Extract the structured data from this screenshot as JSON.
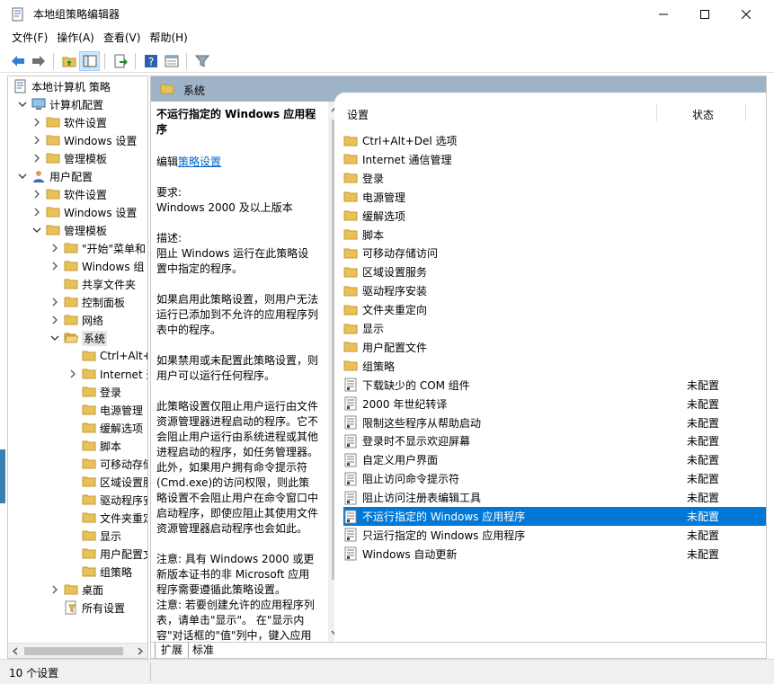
{
  "window": {
    "title": "本地组策略编辑器",
    "minimize_glyph": "—",
    "maximize_glyph": "☐",
    "close_glyph": "✕"
  },
  "menu": [
    "文件(F)",
    "操作(A)",
    "查看(V)",
    "帮助(H)"
  ],
  "toolbar": [
    "back-icon",
    "forward-icon",
    "up-folder-icon",
    "show-hide-tree-icon",
    "export-icon",
    "help-icon",
    "properties-icon",
    "filter-icon"
  ],
  "tree": [
    {
      "label": "本地计算机 策略",
      "icon": "policy-doc-icon",
      "expand": "",
      "indent": 0
    },
    {
      "label": "计算机配置",
      "icon": "computer-icon",
      "expand": "down",
      "indent": 1
    },
    {
      "label": "软件设置",
      "icon": "folder-icon",
      "expand": "right",
      "indent": 2
    },
    {
      "label": "Windows 设置",
      "icon": "folder-icon",
      "expand": "right",
      "indent": 2
    },
    {
      "label": "管理模板",
      "icon": "folder-icon",
      "expand": "right",
      "indent": 2
    },
    {
      "label": "用户配置",
      "icon": "user-icon",
      "expand": "down",
      "indent": 1
    },
    {
      "label": "软件设置",
      "icon": "folder-icon",
      "expand": "right",
      "indent": 2
    },
    {
      "label": "Windows 设置",
      "icon": "folder-icon",
      "expand": "right",
      "indent": 2
    },
    {
      "label": "管理模板",
      "icon": "folder-icon",
      "expand": "down",
      "indent": 2
    },
    {
      "label": "\"开始\"菜单和",
      "icon": "folder-icon",
      "expand": "right",
      "indent": 3
    },
    {
      "label": "Windows 组",
      "icon": "folder-icon",
      "expand": "right",
      "indent": 3
    },
    {
      "label": "共享文件夹",
      "icon": "folder-icon",
      "expand": "",
      "indent": 3
    },
    {
      "label": "控制面板",
      "icon": "folder-icon",
      "expand": "right",
      "indent": 3
    },
    {
      "label": "网络",
      "icon": "folder-icon",
      "expand": "right",
      "indent": 3
    },
    {
      "label": "系统",
      "icon": "folder-open-icon",
      "expand": "down",
      "indent": 3,
      "selected": true
    },
    {
      "label": "Ctrl+Alt+",
      "icon": "folder-icon",
      "expand": "",
      "indent": 4
    },
    {
      "label": "Internet 通",
      "icon": "folder-icon",
      "expand": "right",
      "indent": 4
    },
    {
      "label": "登录",
      "icon": "folder-icon",
      "expand": "",
      "indent": 4
    },
    {
      "label": "电源管理",
      "icon": "folder-icon",
      "expand": "",
      "indent": 4
    },
    {
      "label": "缓解选项",
      "icon": "folder-icon",
      "expand": "",
      "indent": 4
    },
    {
      "label": "脚本",
      "icon": "folder-icon",
      "expand": "",
      "indent": 4
    },
    {
      "label": "可移动存储",
      "icon": "folder-icon",
      "expand": "",
      "indent": 4
    },
    {
      "label": "区域设置服",
      "icon": "folder-icon",
      "expand": "",
      "indent": 4
    },
    {
      "label": "驱动程序安",
      "icon": "folder-icon",
      "expand": "",
      "indent": 4
    },
    {
      "label": "文件夹重定",
      "icon": "folder-icon",
      "expand": "",
      "indent": 4
    },
    {
      "label": "显示",
      "icon": "folder-icon",
      "expand": "",
      "indent": 4
    },
    {
      "label": "用户配置文",
      "icon": "folder-icon",
      "expand": "",
      "indent": 4
    },
    {
      "label": "组策略",
      "icon": "folder-icon",
      "expand": "",
      "indent": 4
    },
    {
      "label": "桌面",
      "icon": "folder-icon",
      "expand": "right",
      "indent": 3
    },
    {
      "label": "所有设置",
      "icon": "all-settings-icon",
      "expand": "",
      "indent": 3
    }
  ],
  "pane_header": "系统",
  "description": {
    "title": "不运行指定的 Windows 应用程序",
    "edit_prefix": "编辑",
    "edit_link": "策略设置",
    "requirements_label": "要求:",
    "requirements_value": "Windows 2000 及以上版本",
    "desc_label": "描述:",
    "desc_text": "阻止 Windows 运行在此策略设置中指定的程序。",
    "enabled_text": "如果启用此策略设置，则用户无法运行已添加到不允许的应用程序列表中的程序。",
    "disabled_text": "如果禁用或未配置此策略设置，则用户可以运行任何程序。",
    "scope_text": "此策略设置仅阻止用户运行由文件资源管理器进程启动的程序。它不会阻止用户运行由系统进程或其他进程启动的程序，如任务管理器。此外，如果用户拥有命令提示符(Cmd.exe)的访问权限，则此策略设置不会阻止用户在命令窗口中启动程序，即使应阻止其使用文件资源管理器启动程序也会如此。",
    "note1": "注意: 具有 Windows 2000 或更新版本证书的非 Microsoft 应用程序需要遵循此策略设置。",
    "note2": "注意: 若要创建允许的应用程序列表，请单击\"显示\"。 在\"显示内容\"对话框的\"值\"列中，键入应用程序可执行文件名(例如"
  },
  "columns": {
    "setting": "设置",
    "state": "状态"
  },
  "list": [
    {
      "name": "Ctrl+Alt+Del 选项",
      "type": "folder",
      "state": ""
    },
    {
      "name": "Internet 通信管理",
      "type": "folder",
      "state": ""
    },
    {
      "name": "登录",
      "type": "folder",
      "state": ""
    },
    {
      "name": "电源管理",
      "type": "folder",
      "state": ""
    },
    {
      "name": "缓解选项",
      "type": "folder",
      "state": ""
    },
    {
      "name": "脚本",
      "type": "folder",
      "state": ""
    },
    {
      "name": "可移动存储访问",
      "type": "folder",
      "state": ""
    },
    {
      "name": "区域设置服务",
      "type": "folder",
      "state": ""
    },
    {
      "name": "驱动程序安装",
      "type": "folder",
      "state": ""
    },
    {
      "name": "文件夹重定向",
      "type": "folder",
      "state": ""
    },
    {
      "name": "显示",
      "type": "folder",
      "state": ""
    },
    {
      "name": "用户配置文件",
      "type": "folder",
      "state": ""
    },
    {
      "name": "组策略",
      "type": "folder",
      "state": ""
    },
    {
      "name": "下载缺少的 COM 组件",
      "type": "setting",
      "state": "未配置"
    },
    {
      "name": "2000 年世纪转译",
      "type": "setting",
      "state": "未配置"
    },
    {
      "name": "限制这些程序从帮助启动",
      "type": "setting",
      "state": "未配置"
    },
    {
      "name": "登录时不显示欢迎屏幕",
      "type": "setting",
      "state": "未配置"
    },
    {
      "name": "自定义用户界面",
      "type": "setting",
      "state": "未配置"
    },
    {
      "name": "阻止访问命令提示符",
      "type": "setting",
      "state": "未配置"
    },
    {
      "name": "阻止访问注册表编辑工具",
      "type": "setting",
      "state": "未配置"
    },
    {
      "name": "不运行指定的 Windows 应用程序",
      "type": "setting",
      "state": "未配置",
      "selected": true
    },
    {
      "name": "只运行指定的 Windows 应用程序",
      "type": "setting",
      "state": "未配置"
    },
    {
      "name": "Windows 自动更新",
      "type": "setting",
      "state": "未配置"
    }
  ],
  "tabs": [
    {
      "label": "扩展",
      "active": true
    },
    {
      "label": "标准",
      "active": false
    }
  ],
  "status": "10 个设置",
  "colors": {
    "header_bg": "#9fb3c8",
    "selection": "#0078d7",
    "folder": "#e8c15a",
    "link": "#0066cc"
  }
}
